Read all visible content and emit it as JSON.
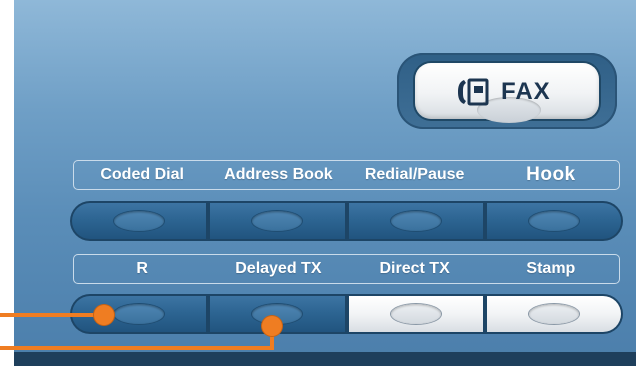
{
  "fax_button": {
    "label": "FAX",
    "icon": "phone-fax-icon"
  },
  "row1": {
    "labels": [
      "Coded Dial",
      "Address Book",
      "Redial/Pause",
      "Hook"
    ],
    "keys": [
      "dark",
      "dark",
      "dark",
      "dark"
    ]
  },
  "row2": {
    "labels": [
      "R",
      "Delayed TX",
      "Direct TX",
      "Stamp"
    ],
    "keys": [
      "dark",
      "dark",
      "light",
      "light"
    ]
  },
  "colors": {
    "panel_blue": "#5a8db8",
    "callout_orange": "#ef7d22",
    "key_blue": "#2d6592",
    "key_white": "#f2f4f6"
  }
}
